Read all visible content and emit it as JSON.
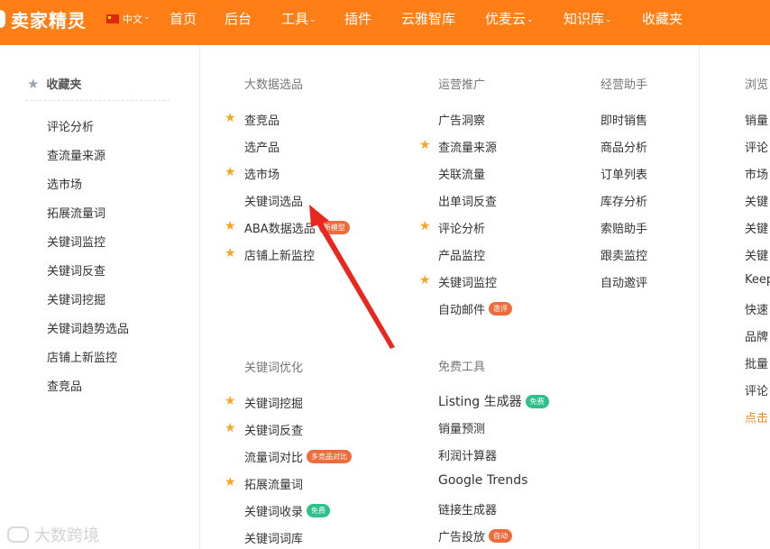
{
  "brand": {
    "name": "卖家精灵"
  },
  "header": {
    "language": "中文",
    "nav": [
      {
        "label": "首页"
      },
      {
        "label": "后台"
      },
      {
        "label": "工具"
      },
      {
        "label": "插件"
      },
      {
        "label": "云雅智库"
      },
      {
        "label": "优麦云"
      },
      {
        "label": "知识库"
      },
      {
        "label": "收藏夹"
      }
    ]
  },
  "favorites": {
    "title": "收藏夹",
    "items": [
      "评论分析",
      "查流量来源",
      "选市场",
      "拓展流量词",
      "关键词监控",
      "关键词反查",
      "关键词挖掘",
      "关键词趋势选品",
      "店铺上新监控",
      "查竞品"
    ]
  },
  "bigdata": {
    "title": "大数据选品",
    "items": [
      {
        "label": "查竞品",
        "starred": true
      },
      {
        "label": "选产品",
        "starred": false
      },
      {
        "label": "选市场",
        "starred": true
      },
      {
        "label": "关键词选品",
        "starred": false
      },
      {
        "label": "ABA数据选品",
        "starred": true,
        "badge": "新模型"
      },
      {
        "label": "店铺上新监控",
        "starred": true
      }
    ]
  },
  "keywordopt": {
    "title": "关键词优化",
    "items": [
      {
        "label": "关键词挖掘",
        "starred": true
      },
      {
        "label": "关键词反查",
        "starred": true
      },
      {
        "label": "流量词对比",
        "starred": false,
        "badge": "多竞品对比"
      },
      {
        "label": "拓展流量词",
        "starred": true
      },
      {
        "label": "关键词收录",
        "starred": false,
        "badge": "免费"
      },
      {
        "label": "关键词词库",
        "starred": false
      }
    ]
  },
  "operations": {
    "title": "运营推广",
    "items": [
      {
        "label": "广告洞察",
        "starred": false
      },
      {
        "label": "查流量来源",
        "starred": true
      },
      {
        "label": "关联流量",
        "starred": false
      },
      {
        "label": "出单词反查",
        "starred": false
      },
      {
        "label": "评论分析",
        "starred": true
      },
      {
        "label": "产品监控",
        "starred": false
      },
      {
        "label": "关键词监控",
        "starred": true
      },
      {
        "label": "自动邮件",
        "starred": false,
        "badge": "邀评"
      }
    ]
  },
  "freetools": {
    "title": "免费工具",
    "items": [
      {
        "label": "Listing 生成器",
        "badge": "免费"
      },
      {
        "label": "销量预测"
      },
      {
        "label": "利润计算器"
      },
      {
        "label": "Google Trends"
      },
      {
        "label": "链接生成器"
      },
      {
        "label": "广告投放",
        "badge": "自动"
      }
    ]
  },
  "assistant": {
    "title": "经营助手",
    "items": [
      "即时销售",
      "商品分析",
      "订单列表",
      "库存分析",
      "索赔助手",
      "跟卖监控",
      "自动邀评"
    ]
  },
  "browse": {
    "title": "浏览",
    "items": [
      "销量",
      "评论",
      "市场",
      "关键",
      "关键",
      "关键",
      "Keep",
      "快速",
      "品牌",
      "批量",
      "评论",
      "点击"
    ]
  },
  "watermark": "大数跨境",
  "colors": {
    "brand": "#ff7e15",
    "star": "#f5a623",
    "badge_orange": "#ee6b3b",
    "badge_green": "#2ec08b",
    "arrow": "#e8281e"
  }
}
